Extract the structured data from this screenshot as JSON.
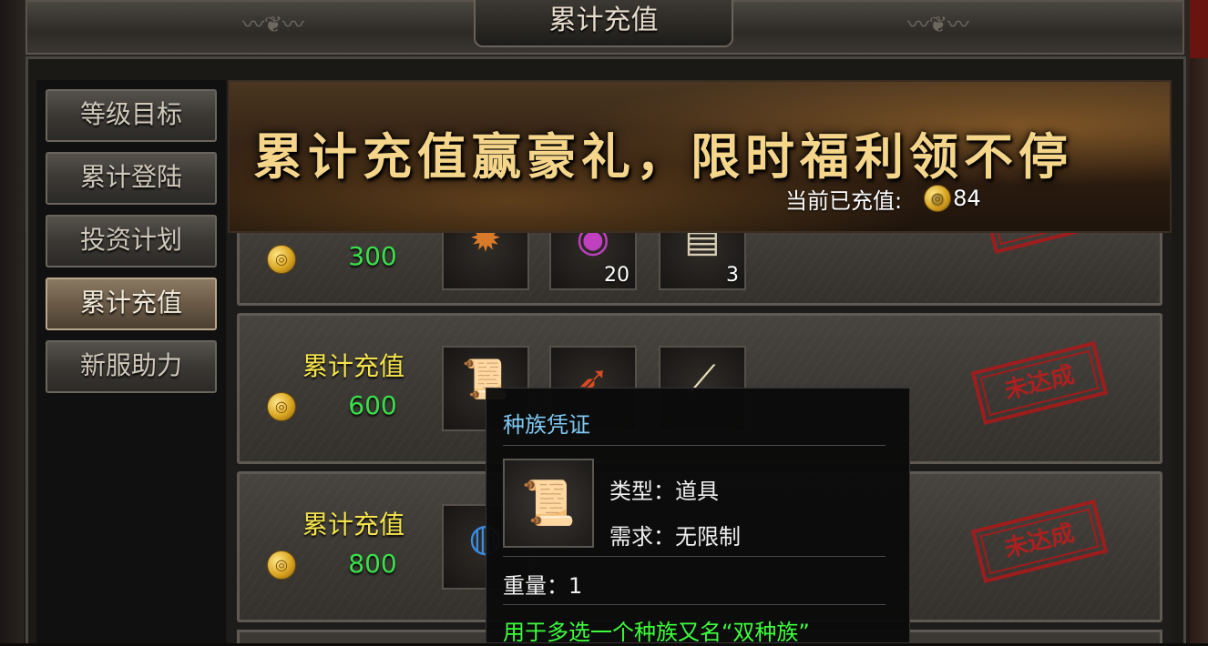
{
  "window": {
    "title": "累计充值"
  },
  "sidebar": {
    "items": [
      {
        "label": "等级目标"
      },
      {
        "label": "累计登陆"
      },
      {
        "label": "投资计划"
      },
      {
        "label": "累计充值"
      },
      {
        "label": "新服助力"
      }
    ],
    "active_index": 3
  },
  "banner": {
    "slogan": "累计充值赢豪礼，限时福利领不停",
    "recharge_label": "当前已充值:",
    "recharge_value": "84"
  },
  "rows": [
    {
      "label": "",
      "amount": "300",
      "items": [
        {
          "icon": "fire-orb-icon",
          "qty": ""
        },
        {
          "icon": "purple-gem-icon",
          "qty": "20"
        },
        {
          "icon": "scroll-box-icon",
          "qty": "3"
        }
      ]
    },
    {
      "label": "累计充值",
      "amount": "600",
      "items": [
        {
          "icon": "parchment-scroll-icon",
          "qty": ""
        },
        {
          "icon": "red-feather-icon",
          "qty": ""
        },
        {
          "icon": "bone-icon",
          "qty": ""
        }
      ],
      "stamp": "未达成"
    },
    {
      "label": "累计充值",
      "amount": "800",
      "items": [
        {
          "icon": "blue-orb-icon",
          "qty": ""
        }
      ],
      "stamp": "未达成"
    }
  ],
  "tooltip": {
    "name": "种族凭证",
    "type_line": "类型：道具",
    "requirement_line": "需求：无限制",
    "weight_line": "重量：1",
    "description": "用于多选一个种族又名“双种族”"
  },
  "colors": {
    "amount_green": "#39e04a",
    "label_yellow": "#f5e44a",
    "tooltip_name_blue": "#7fc8f2",
    "stamp_red": "#c01c1c"
  }
}
